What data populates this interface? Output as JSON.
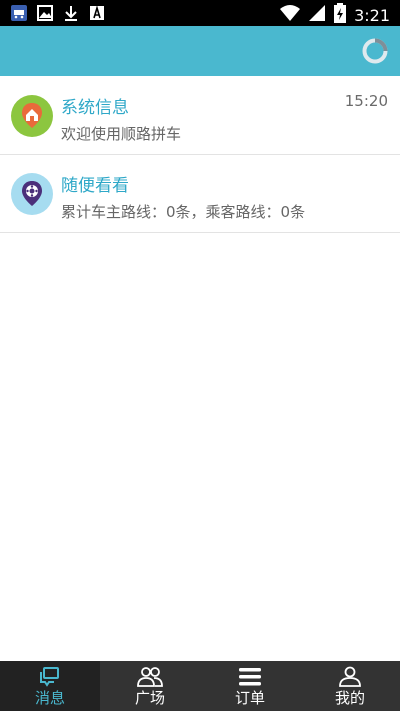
{
  "status_bar": {
    "time": "3:21",
    "icons": [
      "car-icon",
      "image-icon",
      "download-icon",
      "font-icon"
    ],
    "right_icons": [
      "wifi-icon",
      "signal-icon",
      "battery-charging-icon"
    ]
  },
  "header": {
    "color": "#4ab8cf",
    "loading_icon": "spinner-icon"
  },
  "messages": [
    {
      "title": "系统信息",
      "subtitle": "欢迎使用顺路拼车",
      "time": "15:20",
      "icon": "home-pin-icon",
      "icon_bg": "#8cc63f"
    },
    {
      "title": "随便看看",
      "subtitle": "累计车主路线：0条，乘客路线：0条",
      "time": "",
      "icon": "car-pin-icon",
      "icon_bg": "#a6dcf0"
    }
  ],
  "tabs": [
    {
      "label": "消息",
      "icon": "message-icon",
      "active": true
    },
    {
      "label": "广场",
      "icon": "people-icon",
      "active": false
    },
    {
      "label": "订单",
      "icon": "list-icon",
      "active": false
    },
    {
      "label": "我的",
      "icon": "person-icon",
      "active": false
    }
  ],
  "colors": {
    "accent": "#4ab8cf",
    "title_text": "#2fa8c8",
    "tabbar_bg": "#333333"
  }
}
